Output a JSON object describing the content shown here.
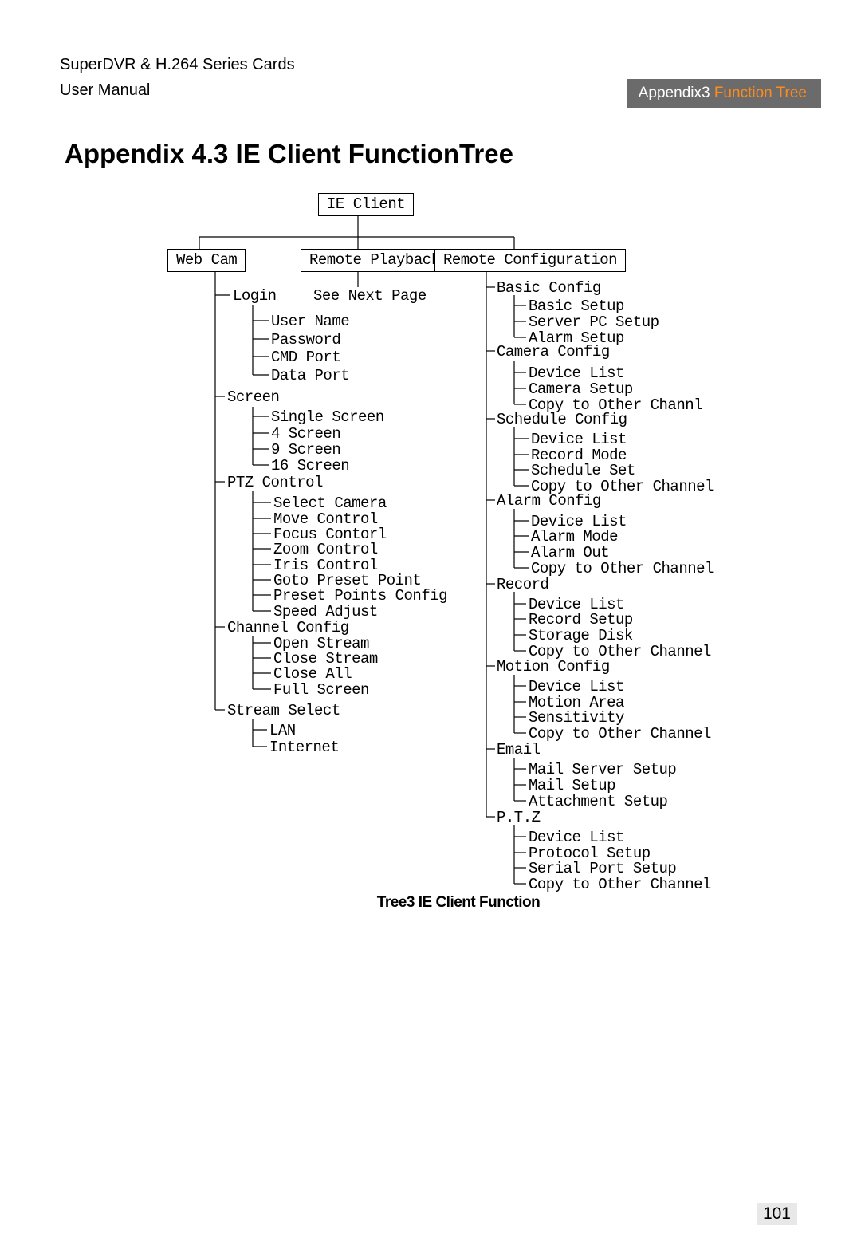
{
  "header": {
    "product_line": "SuperDVR & H.264 Series Cards",
    "doc_type": "User Manual",
    "section_label_prefix": "Appendix3 ",
    "section_label_accent": "Function Tree"
  },
  "title": "Appendix 4.3 IE Client FunctionTree",
  "tree": {
    "root": "IE Client",
    "branches": {
      "web_cam": {
        "label": "Web Cam",
        "login": {
          "label": "Login",
          "items": [
            "User Name",
            "Password",
            "CMD Port",
            "Data Port"
          ]
        },
        "screen": {
          "label": "Screen",
          "items": [
            "Single Screen",
            "4 Screen",
            "9 Screen",
            "16 Screen"
          ]
        },
        "ptz_control": {
          "label": "PTZ Control",
          "items": [
            "Select Camera",
            "Move Control",
            "Focus Contorl",
            "Zoom Control",
            "Iris Control",
            "Goto Preset Point",
            "Preset Points Config",
            "Speed Adjust"
          ]
        },
        "channel_config": {
          "label": "Channel Config",
          "items": [
            "Open Stream",
            "Close Stream",
            "Close All",
            "Full Screen"
          ]
        },
        "stream_select": {
          "label": "Stream Select",
          "items": [
            "LAN",
            "Internet"
          ]
        }
      },
      "remote_playback": {
        "label": "Remote Playback",
        "note": "See Next Page"
      },
      "remote_config": {
        "label": "Remote Configuration",
        "basic_config": {
          "label": "Basic Config",
          "items": [
            "Basic Setup",
            "Server PC Setup",
            "Alarm Setup"
          ]
        },
        "camera_config": {
          "label": "Camera Config",
          "items": [
            "Device List",
            "Camera Setup",
            "Copy to Other Channl"
          ]
        },
        "schedule_config": {
          "label": "Schedule Config",
          "items": [
            "Device List",
            "Record Mode",
            "Schedule Set",
            "Copy to Other Channel"
          ]
        },
        "alarm_config": {
          "label": "Alarm Config",
          "items": [
            "Device List",
            "Alarm Mode",
            "Alarm Out",
            "Copy to Other Channel"
          ]
        },
        "record": {
          "label": "Record",
          "items": [
            "Device List",
            "Record Setup",
            "Storage Disk",
            "Copy to Other Channel"
          ]
        },
        "motion_config": {
          "label": "Motion Config",
          "items": [
            "Device List",
            "Motion Area",
            "Sensitivity",
            "Copy to Other Channel"
          ]
        },
        "email": {
          "label": "Email",
          "items": [
            "Mail Server Setup",
            "Mail Setup",
            "Attachment Setup"
          ]
        },
        "ptz": {
          "label": "P.T.Z",
          "items": [
            "Device List",
            "Protocol Setup",
            "Serial Port Setup",
            "Copy to Other Channel"
          ]
        }
      }
    }
  },
  "caption": "Tree3 IE Client Function",
  "page_number": "101"
}
